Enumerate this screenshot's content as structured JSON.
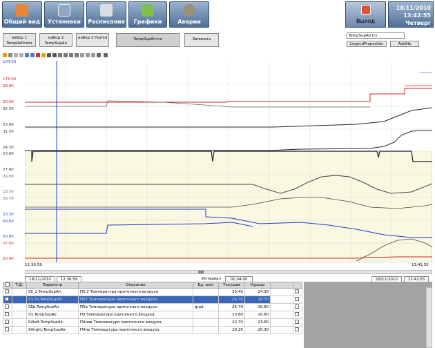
{
  "nav": {
    "buttons": [
      {
        "label": "Общий вид",
        "icon": "home-icon",
        "color": "#e8873a"
      },
      {
        "label": "Установки",
        "icon": "settings-icon",
        "color": "#8fa6c4"
      },
      {
        "label": "Расписания",
        "icon": "schedule-icon",
        "color": "#d9dde4"
      },
      {
        "label": "Графики",
        "icon": "chart-icon",
        "color": "#7fbf4f"
      },
      {
        "label": "Аварии",
        "icon": "alarm-icon",
        "color": "#9a8f7a"
      }
    ],
    "exit_label": "Выход",
    "date": "18/11/2010",
    "time": "13:42:55",
    "weekday": "Четверг"
  },
  "trend_sets": {
    "set1": "набор 1 TempRefIndor",
    "set2": "набор 2 TempSupAir",
    "set3": "набор 3 Humid",
    "active": "TempSupAir.trx",
    "save": "Записать"
  },
  "right_panel": {
    "file_select": "TempSupAir.trx",
    "legend_button": "LegendProperties",
    "add_button": "Addfile"
  },
  "time_axis": {
    "start": "12:36:59",
    "end": "13:42:55",
    "interval_label": "Интервал",
    "interval_value": "01:04:00"
  },
  "range_bar": {
    "from_date": "18/11/2010",
    "from_time": "12:36:59",
    "to_date": "18/11/2010",
    "to_time": "13:42:55"
  },
  "y_labels": {
    "l1": "104.00",
    "l2": "175.00",
    "l3": "29.90",
    "l4": "20.00",
    "l5": "35.30",
    "l6": "23.90",
    "l7": "31.50",
    "l8": "24.30",
    "l9": "23.60",
    "l10": "27.40",
    "l11": "29.00",
    "l12": "13.50",
    "l13": "29.70",
    "l14": "23.30",
    "l15": "59.60",
    "l16": "50.00",
    "l17": "27.00",
    "l18": "20.40"
  },
  "table": {
    "headers": [
      "Т.Д.",
      "Параметр",
      "Описание",
      "Ед. изм.",
      "Текущее",
      "Курсор"
    ],
    "rows": [
      {
        "param": "S5_2.TempSupAir",
        "desc": "П5.2 Температура приточного воздуха",
        "unit": "",
        "current": "25.40",
        "cursor": "24.30"
      },
      {
        "param": "S3.7s.TempSupAir",
        "desc": "П07 Температура приточного воздуха",
        "unit": "",
        "current": "24.70",
        "cursor": "19.70"
      },
      {
        "param": "S5b.TempSupAir",
        "desc": "П5b Температура приточного воздуха",
        "unit": "grad",
        "current": "25.70",
        "cursor": "30.80"
      },
      {
        "param": "S3.TempSupAir",
        "desc": "П3 Температура приточного воздуха",
        "unit": "",
        "current": "23.80",
        "cursor": "20.80"
      },
      {
        "param": "S4left.TempSupAir",
        "desc": "П4лев Температура приточного воздуха",
        "unit": "",
        "current": "22.70",
        "cursor": "23.60"
      },
      {
        "param": "S4right.TempSupAir",
        "desc": "П4пр Температура приточного воздуха",
        "unit": "",
        "current": "29.20",
        "cursor": "20.30"
      }
    ]
  }
}
